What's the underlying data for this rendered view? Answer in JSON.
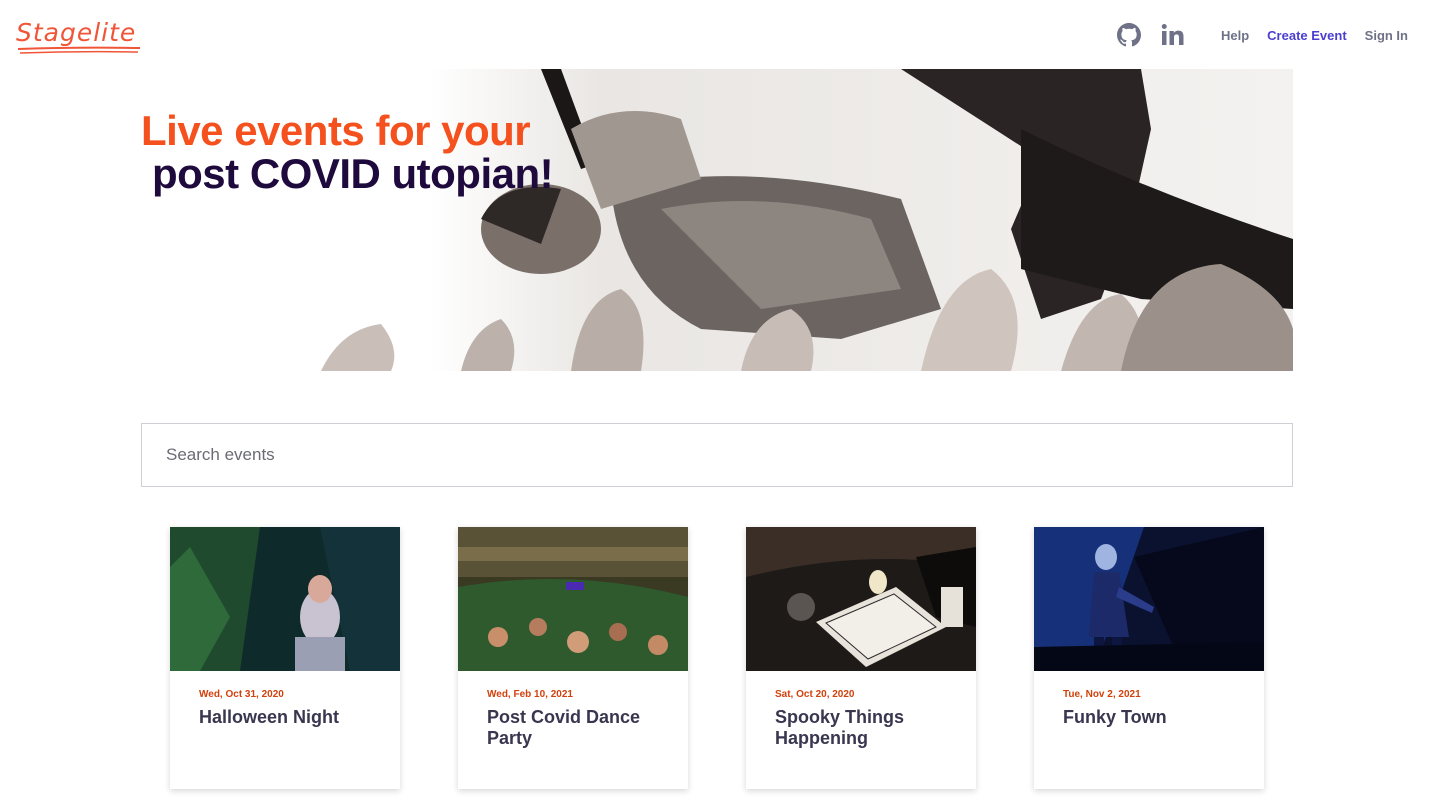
{
  "header": {
    "logo_text": "Stagelite",
    "nav": {
      "github_icon": "github-icon",
      "linkedin_icon": "linkedin-icon",
      "help": "Help",
      "create_event": "Create Event",
      "sign_in": "Sign In"
    }
  },
  "hero": {
    "line1": "Live events for your",
    "line2": "post COVID utopian!"
  },
  "search": {
    "placeholder": "Search events",
    "value": ""
  },
  "events": [
    {
      "date": "Wed, Oct 31, 2020",
      "title": "Halloween Night"
    },
    {
      "date": "Wed, Feb 10, 2021",
      "title": "Post Covid Dance Party"
    },
    {
      "date": "Sat, Oct 20, 2020",
      "title": "Spooky Things Happening"
    },
    {
      "date": "Tue, Nov 2, 2021",
      "title": "Funky Town"
    }
  ],
  "colors": {
    "brand": "#f05537",
    "hero_line1": "#f4511e",
    "hero_line2": "#1e0a3c",
    "date": "#d1410c",
    "nav_accent": "#4b3fd0"
  }
}
